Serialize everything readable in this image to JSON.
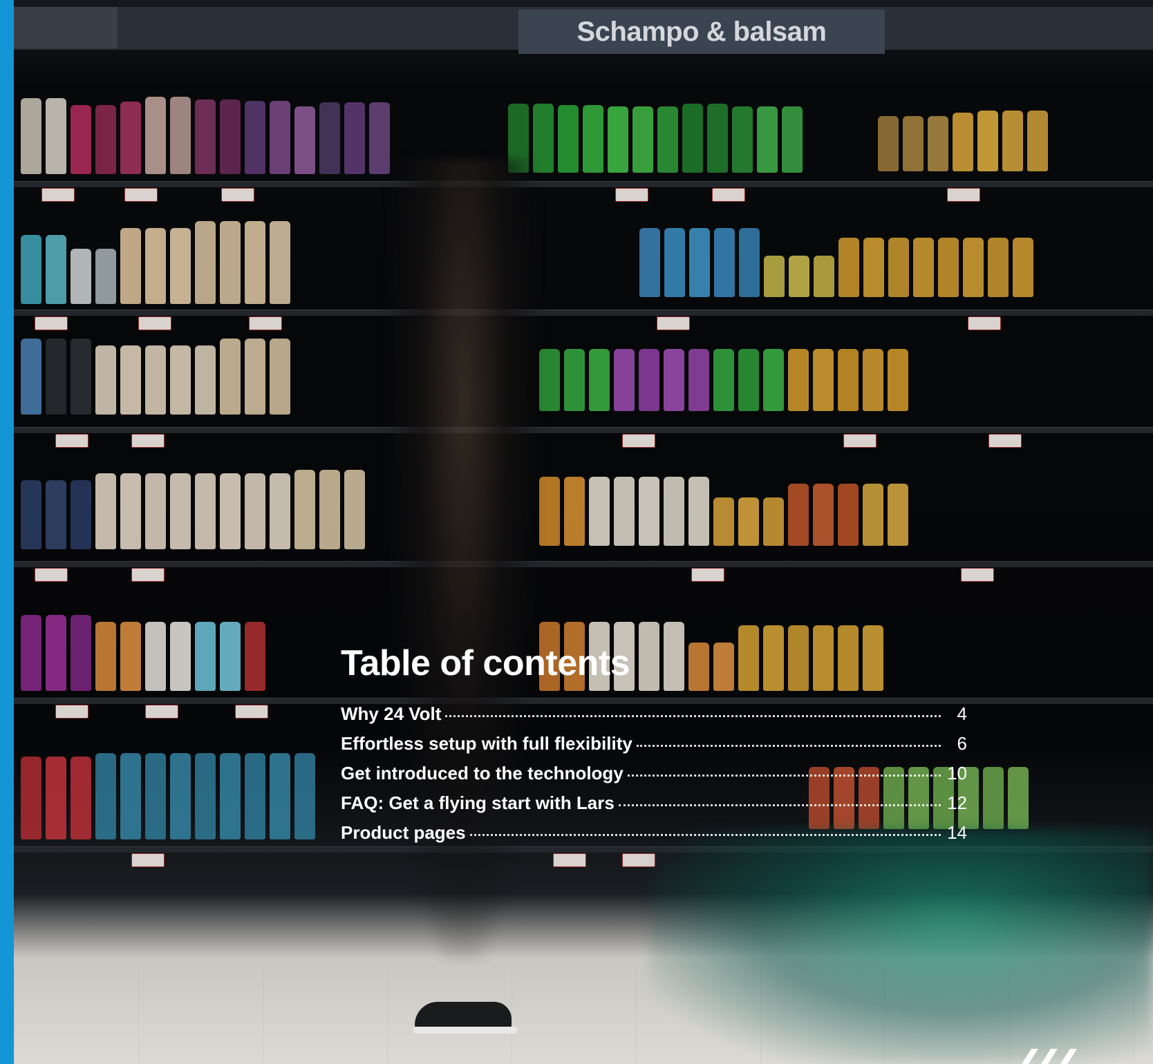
{
  "sign": {
    "text": "Schampo & balsam"
  },
  "toc": {
    "title": "Table of contents",
    "entries": [
      {
        "label": "Why 24 Volt",
        "page": "4"
      },
      {
        "label": "Effortless setup with full flexibility",
        "page": "6"
      },
      {
        "label": "Get introduced to the technology",
        "page": "10"
      },
      {
        "label": "FAQ: Get a flying start with Lars",
        "page": "12"
      },
      {
        "label": "Product pages",
        "page": "14"
      }
    ]
  },
  "colors": {
    "accent_strip": "#1495d6",
    "text": "#ffffff"
  }
}
